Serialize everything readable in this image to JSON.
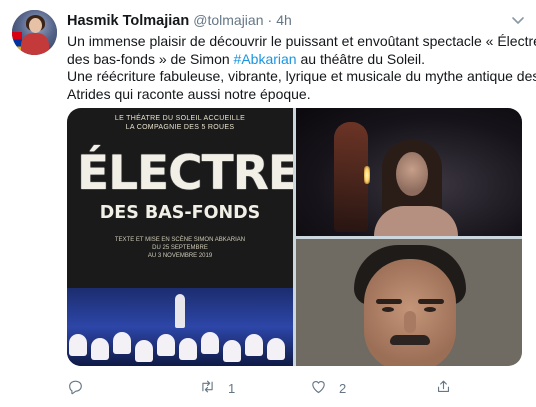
{
  "tweet": {
    "author_name": "Hasmik Tolmajian",
    "handle": "@tolmajian",
    "separator": "·",
    "time": "4h",
    "text_lines": [
      "Un immense plaisir de découvrir le puissant et envoûtant spectacle « Électre",
      "des bas-fonds » de Simon ",
      " au théâtre du Soleil.",
      "Une réécriture fabuleuse, vibrante, lyrique et musicale du mythe antique des",
      "Atrides qui raconte aussi notre époque."
    ],
    "hashtag": "#Abkarian"
  },
  "media": {
    "poster": {
      "top_line_1": "LE THÉATRE DU SOLEIL ACCUEILLE",
      "top_line_2": "LA COMPAGNIE DES 5 ROUES",
      "title": "ÉLECTRE",
      "subtitle": "DES BAS-FONDS",
      "credit_line": "TEXTE ET MISE EN SCÈNE SIMON ABKARIAN",
      "dates_line_1": "DU 25 SEPTEMBRE",
      "dates_line_2": "AU 3 NOVEMBRE 2019"
    }
  },
  "actions": {
    "reply_count": "",
    "retweet_count": "1",
    "like_count": "2",
    "share_count": ""
  },
  "icons": {
    "reply": "reply-icon",
    "retweet": "retweet-icon",
    "like": "heart-icon",
    "share": "share-icon",
    "caret": "chevron-down-icon"
  },
  "colors": {
    "text": "#14171a",
    "secondary": "#657786",
    "link": "#1b95e0"
  }
}
